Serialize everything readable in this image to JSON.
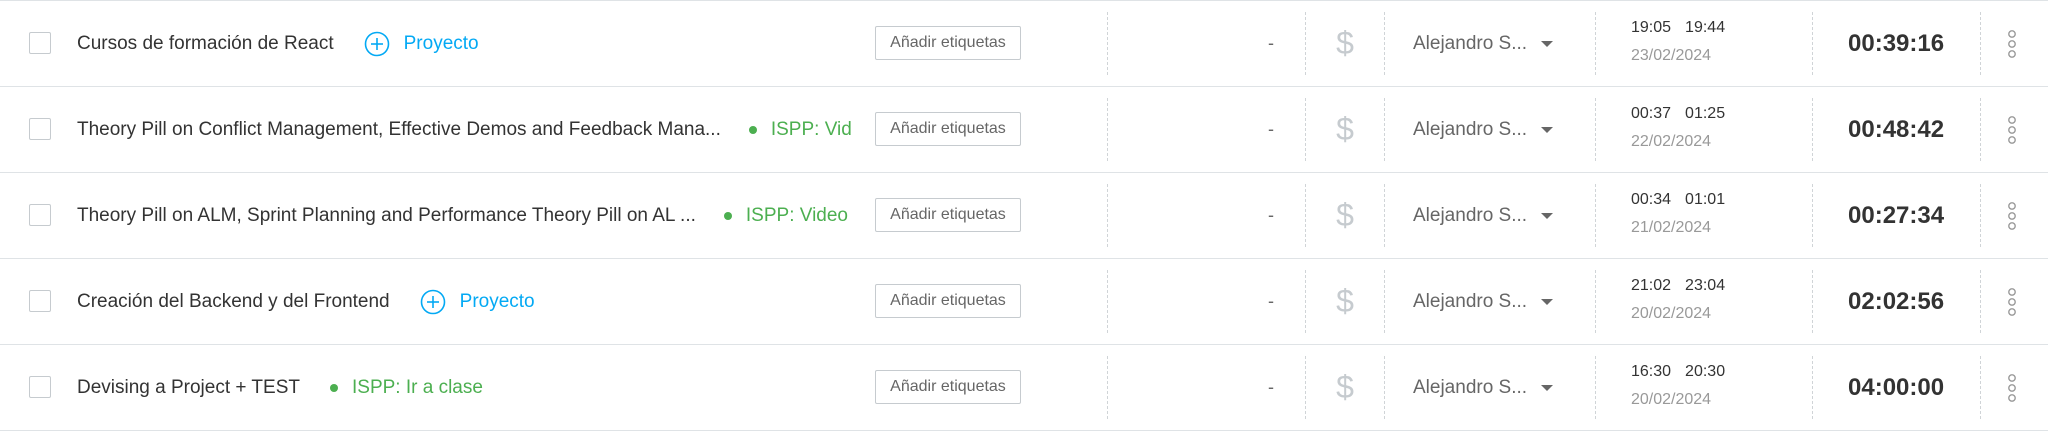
{
  "colors": {
    "project_blue": "#03a9f4",
    "project_green": "#4caf50",
    "border": "#dfe3e6",
    "text": "#333333",
    "muted": "#999999"
  },
  "entries": [
    {
      "description": "Cursos de formación de React",
      "project": {
        "type": "add",
        "label": "Proyecto"
      },
      "tags_label": "Añadir etiquetas",
      "billable_value": "-",
      "billable_icon": "dollar-icon",
      "user": "Alejandro S...",
      "start": "19:05",
      "end": "19:44",
      "date": "23/02/2024",
      "duration": "00:39:16"
    },
    {
      "description": "Theory Pill on Conflict Management, Effective Demos and Feedback Mana...",
      "project": {
        "type": "assigned",
        "label": "ISPP: Vid"
      },
      "tags_label": "Añadir etiquetas",
      "billable_value": "-",
      "billable_icon": "dollar-icon",
      "user": "Alejandro S...",
      "start": "00:37",
      "end": "01:25",
      "date": "22/02/2024",
      "duration": "00:48:42"
    },
    {
      "description": "Theory Pill on ALM, Sprint Planning and Performance Theory Pill on AL ...",
      "project": {
        "type": "assigned",
        "label": "ISPP: Video"
      },
      "tags_label": "Añadir etiquetas",
      "billable_value": "-",
      "billable_icon": "dollar-icon",
      "user": "Alejandro S...",
      "start": "00:34",
      "end": "01:01",
      "date": "21/02/2024",
      "duration": "00:27:34"
    },
    {
      "description": "Creación del Backend y del Frontend",
      "project": {
        "type": "add",
        "label": "Proyecto"
      },
      "tags_label": "Añadir etiquetas",
      "billable_value": "-",
      "billable_icon": "dollar-icon",
      "user": "Alejandro S...",
      "start": "21:02",
      "end": "23:04",
      "date": "20/02/2024",
      "duration": "02:02:56"
    },
    {
      "description": "Devising a Project + TEST",
      "project": {
        "type": "assigned",
        "label": "ISPP: Ir a clase"
      },
      "tags_label": "Añadir etiquetas",
      "billable_value": "-",
      "billable_icon": "dollar-icon",
      "user": "Alejandro S...",
      "start": "16:30",
      "end": "20:30",
      "date": "20/02/2024",
      "duration": "04:00:00"
    }
  ]
}
